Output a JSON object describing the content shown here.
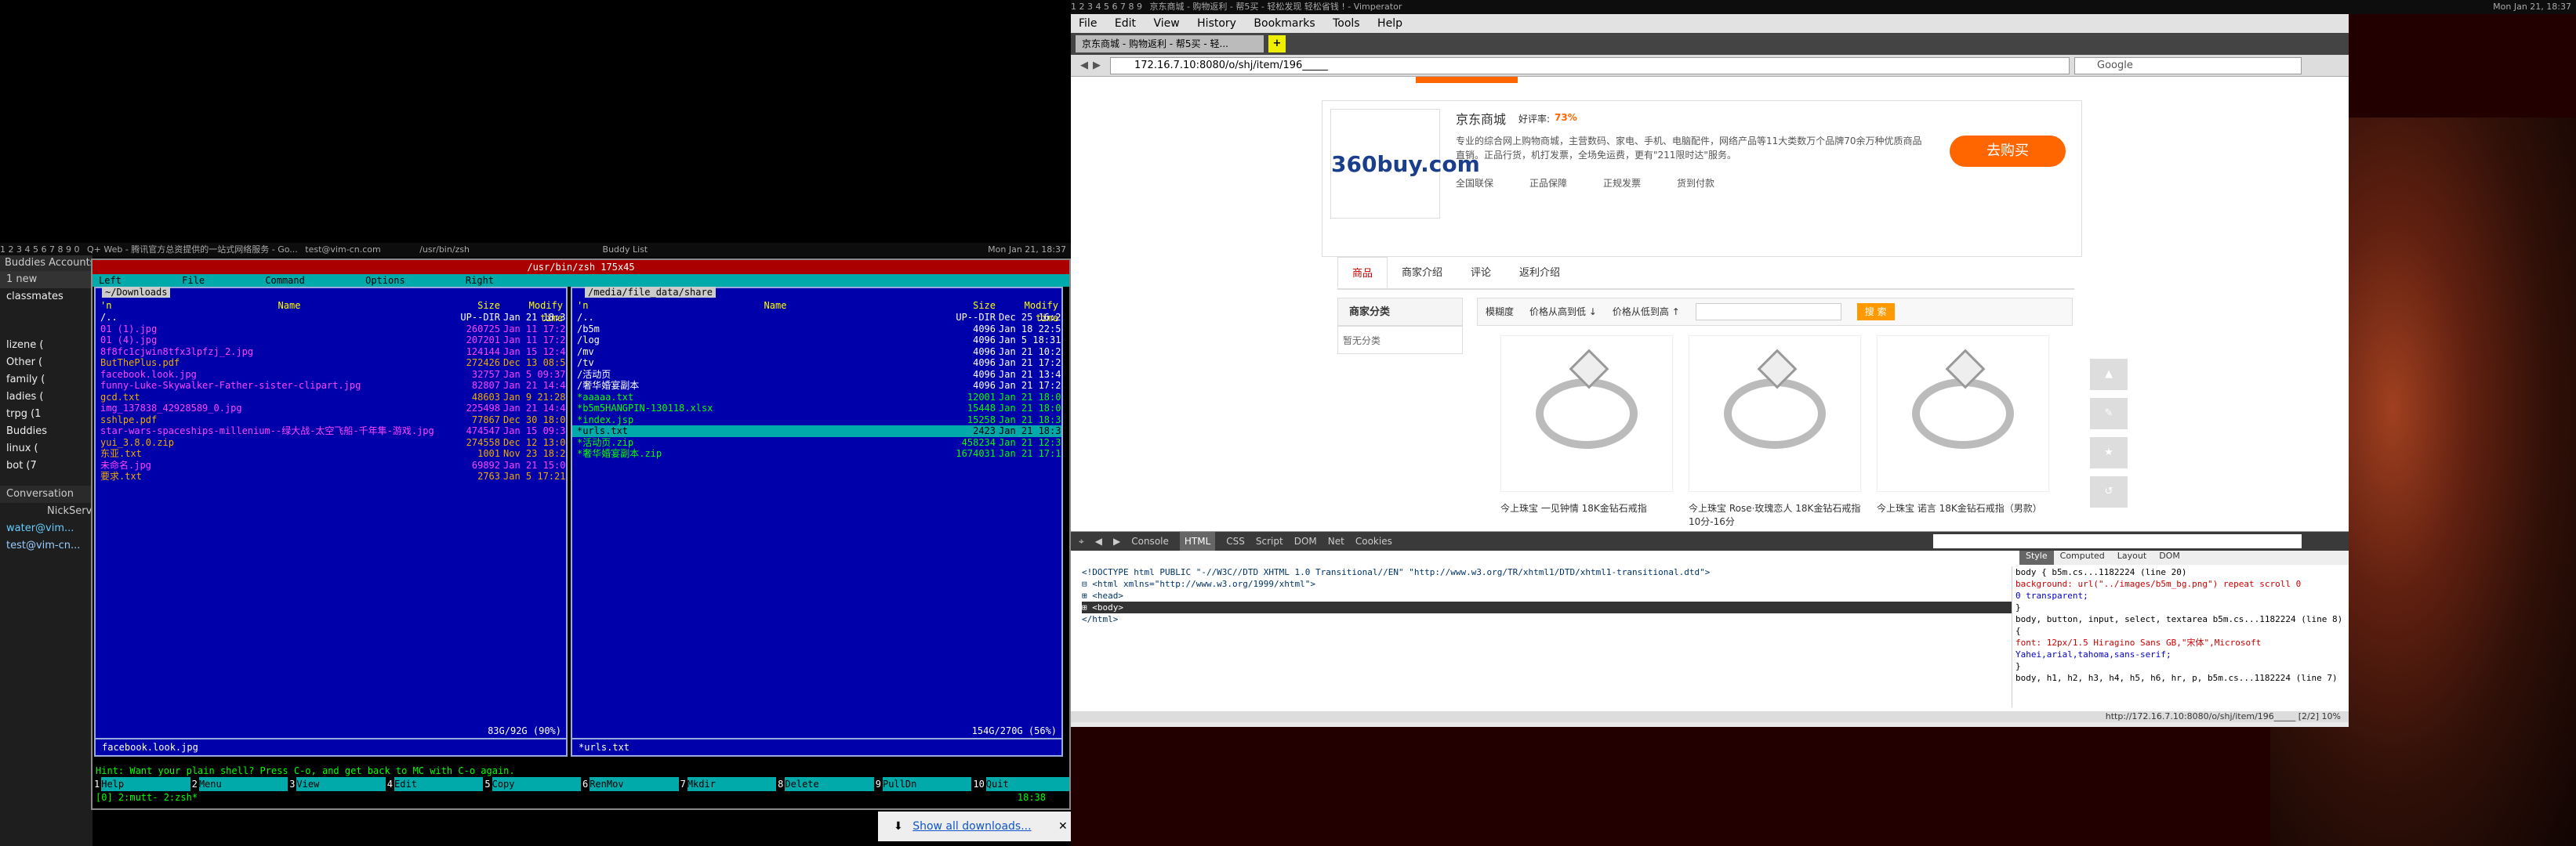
{
  "left_topbar": {
    "workspaces": "1 2 3 4 5 6 7 8 9 0",
    "tasks": [
      "Q+ Web - 腾讯官方总资提供的一站式网络服务 - Go...",
      "test@vim-cn.com",
      "/usr/bin/zsh",
      "Buddy List"
    ],
    "clock": "Mon Jan 21, 18:37"
  },
  "right_topbar": {
    "workspaces": "1 2 3 4 5 6 7 8 9",
    "title": "京东商城 - 购物返利 - 帮5买 - 轻松发现 轻松省钱 ! - Vimperator",
    "clock": "Mon Jan 21, 18:37"
  },
  "pidgin": {
    "menu": "Buddies  Accounts",
    "status_line": "1 new",
    "groups": [
      "classmates",
      "lizene (",
      "Other (",
      "family (",
      "ladies (",
      "trpg (1",
      "Buddies",
      "linux (",
      "bot (7"
    ],
    "conversation_label": "Conversation",
    "nick_header": "NickServ",
    "contacts": [
      "water@vim...",
      "test@vim-cn..."
    ]
  },
  "mc": {
    "title": "/usr/bin/zsh 175x45",
    "menu": [
      "Left",
      "File",
      "Command",
      "Options",
      "Right"
    ],
    "left": {
      "path": "~/Downloads",
      "headers": {
        "name": "Name",
        "size": "Size",
        "time": "Modify time",
        "n": "'n"
      },
      "rows": [
        {
          "name": "/..",
          "size": "UP--DIR",
          "time": "Jan 21 18:38",
          "cls": "f-dir"
        },
        {
          "name": "01 (1).jpg",
          "size": "260725",
          "time": "Jan 11 17:24",
          "cls": "f-img"
        },
        {
          "name": "01 (4).jpg",
          "size": "207201",
          "time": "Jan 11 17:25",
          "cls": "f-img"
        },
        {
          "name": "8f8fc1cjwin8tfx3lpfzj_2.jpg",
          "size": "124144",
          "time": "Jan 15 12:41",
          "cls": "f-img"
        },
        {
          "name": "ButThePlus.pdf",
          "size": "272426",
          "time": "Dec 13 08:52",
          "cls": "f-pdf"
        },
        {
          "name": "facebook.look.jpg",
          "size": "32757",
          "time": "Jan  5 09:37",
          "cls": "f-img"
        },
        {
          "name": "funny-Luke-Skywalker-Father-sister-clipart.jpg",
          "size": "82807",
          "time": "Jan 21 14:48",
          "cls": "f-img"
        },
        {
          "name": "gcd.txt",
          "size": "48603",
          "time": "Jan  9 21:28",
          "cls": "f-pdf"
        },
        {
          "name": "img_137838_42928589_0.jpg",
          "size": "225498",
          "time": "Jan 21 14:47",
          "cls": "f-img"
        },
        {
          "name": "sshlpe.pdf",
          "size": "77867",
          "time": "Dec 30 18:08",
          "cls": "f-pdf"
        },
        {
          "name": "star-wars-spaceships-millenium--绿大战-太空飞船-千年隼-游戏.jpg",
          "size": "474547",
          "time": "Jan 15 09:38",
          "cls": "f-img"
        },
        {
          "name": "yui_3.8.0.zip",
          "size": "274558",
          "time": "Dec 12 13:02",
          "cls": "f-pdf"
        },
        {
          "name": "东亚.txt",
          "size": "1001",
          "time": "Nov 23 18:28",
          "cls": "f-pdf"
        },
        {
          "name": "未命名.jpg",
          "size": "69892",
          "time": "Jan 21 15:04",
          "cls": "f-img"
        },
        {
          "name": "要求.txt",
          "size": "2763",
          "time": "Jan  5 17:21",
          "cls": "f-pdf"
        }
      ],
      "footer": "facebook.look.jpg",
      "free": "83G/92G (90%)"
    },
    "right": {
      "path": "/media/file_data/share",
      "headers": {
        "name": "Name",
        "size": "Size",
        "time": "Modify time",
        "n": "'n"
      },
      "rows": [
        {
          "name": "/..",
          "size": "UP--DIR",
          "time": "Dec 25 16:22",
          "cls": "f-dir"
        },
        {
          "name": "/b5m",
          "size": "4096",
          "time": "Jan 18 22:58",
          "cls": "f-dir"
        },
        {
          "name": "/log",
          "size": "4096",
          "time": "Jan  5 18:31",
          "cls": "f-dir"
        },
        {
          "name": "/mv",
          "size": "4096",
          "time": "Jan 21 10:25",
          "cls": "f-dir"
        },
        {
          "name": "/tv",
          "size": "4096",
          "time": "Jan 21 17:28",
          "cls": "f-dir"
        },
        {
          "name": "/活动页",
          "size": "4096",
          "time": "Jan 21 13:45",
          "cls": "f-dir"
        },
        {
          "name": "/奢华婚宴副本",
          "size": "4096",
          "time": "Jan 21 17:20",
          "cls": "f-dir"
        },
        {
          "name": "*aaaaa.txt",
          "size": "12001",
          "time": "Jan 21 18:09",
          "cls": "f-ex"
        },
        {
          "name": "*b5m5HANGPIN-130118.xlsx",
          "size": "15448",
          "time": "Jan 21 18:00",
          "cls": "f-ex"
        },
        {
          "name": "*index.jsp",
          "size": "15258",
          "time": "Jan 21 18:38",
          "cls": "f-ex"
        },
        {
          "name": "*urls.txt",
          "size": "2423",
          "time": "Jan 21 18:37",
          "cls": "sel"
        },
        {
          "name": "*活动页.zip",
          "size": "458234",
          "time": "Jan 21 12:36",
          "cls": "f-ex"
        },
        {
          "name": "*奢华婚宴副本.zip",
          "size": "1674031",
          "time": "Jan 21 17:19",
          "cls": "f-ex"
        }
      ],
      "footer": "*urls.txt",
      "free": "154G/270G (56%)"
    },
    "hint": "Hint: Want your plain shell? Press C-o, and get back to MC with C-o again.",
    "fkeys": [
      {
        "n": "1",
        "l": "Help"
      },
      {
        "n": "2",
        "l": "Menu"
      },
      {
        "n": "3",
        "l": "View"
      },
      {
        "n": "4",
        "l": "Edit"
      },
      {
        "n": "5",
        "l": "Copy"
      },
      {
        "n": "6",
        "l": "RenMov"
      },
      {
        "n": "7",
        "l": "Mkdir"
      },
      {
        "n": "8",
        "l": "Delete"
      },
      {
        "n": "9",
        "l": "PullDn"
      },
      {
        "n": "10",
        "l": "Quit"
      }
    ],
    "prompt": "[0] 2:mutt- 2:zsh*",
    "clock": "18:38"
  },
  "downloads_bar": {
    "label": "Show all downloads...",
    "close": "✕"
  },
  "firefox": {
    "menu": [
      "File",
      "Edit",
      "View",
      "History",
      "Bookmarks",
      "Tools",
      "Help"
    ],
    "tab_title": "京东商城 - 购物返利 - 帮5买 - 轻...",
    "url": "172.16.7.10:8080/o/shj/item/196_____",
    "search_placeholder": "Google",
    "shop": {
      "logo": "360buy.com",
      "name": "京东商城",
      "rating_label": "好评率:",
      "rating": "73%",
      "desc": "专业的综合网上购物商城，主营数码、家电、手机、电脑配件，网络产品等11大类数万个品牌70余万种优质商品直销。正品行货，机打发票，全场免运费，更有\"211限时达\"服务。",
      "badges": [
        "全国联保",
        "正品保障",
        "正规发票",
        "货到付款"
      ],
      "buy": "去购买"
    },
    "tabs": [
      "商品",
      "商家介绍",
      "评论",
      "返利介绍"
    ],
    "category_title": "商家分类",
    "category_empty": "暂无分类",
    "sort": [
      "模糊度",
      "价格从高到低 ↓",
      "价格从低到高 ↑"
    ],
    "search_btn": "搜 索",
    "products": [
      "今上珠宝 一见钟情 18K金钻石戒指",
      "今上珠宝 Rose·玫瑰恋人 18K金钻石戒指 10分-16分",
      "今上珠宝 诺言 18K金钻石戒指（男款）"
    ],
    "devtools": {
      "tabs": [
        "Console",
        "HTML",
        "CSS",
        "Script",
        "DOM",
        "Net",
        "Cookies"
      ],
      "side_tabs": [
        "Style",
        "Computed",
        "Layout",
        "DOM"
      ],
      "html_lines": [
        "<!DOCTYPE html PUBLIC \"-//W3C//DTD XHTML 1.0 Transitional//EN\" \"http://www.w3.org/TR/xhtml1/DTD/xhtml1-transitional.dtd\">",
        "⊟ <html xmlns=\"http://www.w3.org/1999/xhtml\">",
        "    ⊞ <head>",
        "    ⊞ <body>",
        "  </html>"
      ],
      "css_lines": [
        "body {                                       b5m.cs...1182224 (line 20)",
        "    background: url(\"../images/b5m_bg.png\") repeat scroll 0",
        "    0 transparent;",
        "}",
        "body, button, input, select, textarea  b5m.cs...1182224 (line 8)",
        "{",
        "    font: 12px/1.5 Hiragino Sans GB,\"宋体\",Microsoft",
        "    Yahei,arial,tahoma,sans-serif;",
        "}",
        "body, h1, h2, h3, h4, h5, h6, hr, p,  b5m.cs...1182224 (line 7)"
      ]
    },
    "status": "http://172.16.7.10:8080/o/shj/item/196_____  [2/2] 10%"
  }
}
